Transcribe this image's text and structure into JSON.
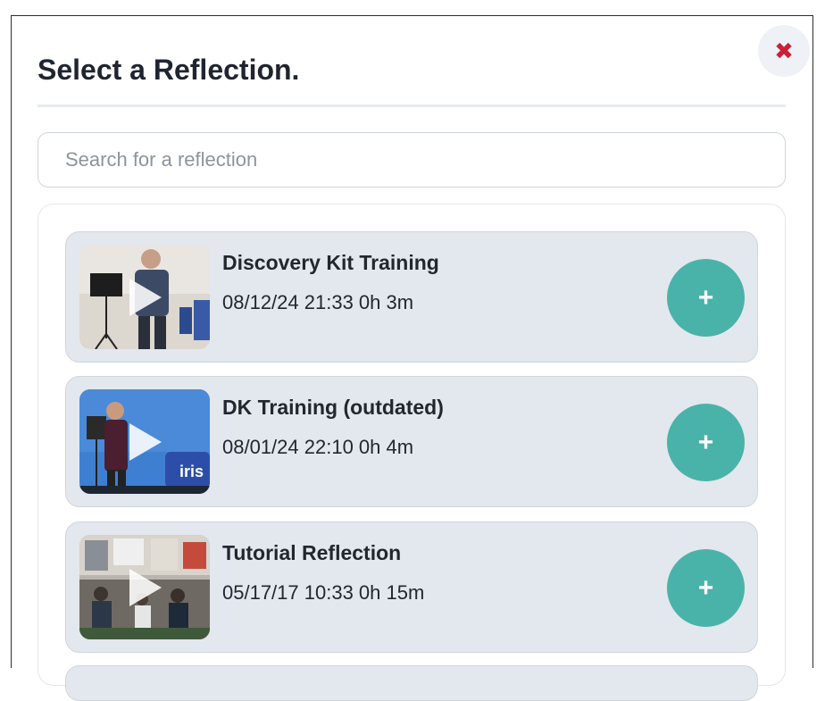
{
  "modal": {
    "title": "Select a Reflection.",
    "close_icon": "close-x-icon",
    "close_color": "#cc1f36"
  },
  "search": {
    "placeholder": "Search for a reflection",
    "value": ""
  },
  "colors": {
    "accent": "#4ab3a9",
    "card_bg": "#e3e7ee"
  },
  "reflections": [
    {
      "title": "Discovery Kit Training",
      "meta": "08/12/24 21:33 0h 3m",
      "action_icon": "plus-icon"
    },
    {
      "title": "DK Training (outdated)",
      "meta": "08/01/24 22:10 0h 4m",
      "action_icon": "plus-icon"
    },
    {
      "title": "Tutorial Reflection",
      "meta": "05/17/17 10:33 0h 15m",
      "action_icon": "plus-icon"
    }
  ],
  "thumbnails": [
    {
      "brand_text": ""
    },
    {
      "brand_text": "iris"
    },
    {
      "brand_text": ""
    }
  ]
}
